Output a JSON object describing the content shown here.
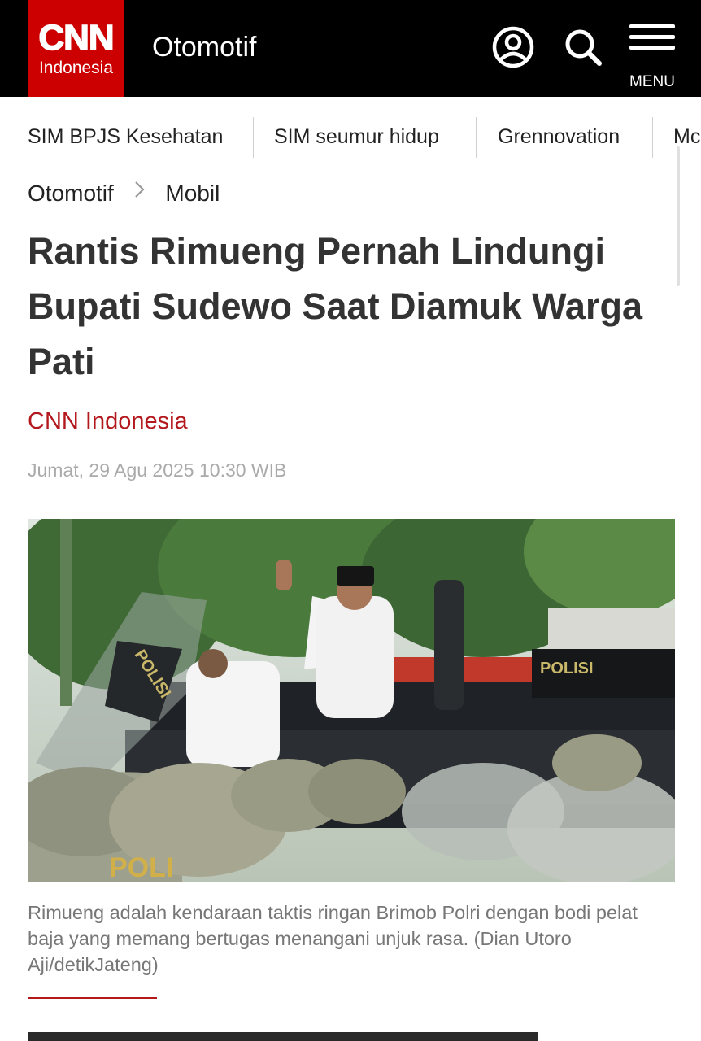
{
  "header": {
    "logo": {
      "brand": "CNN",
      "sub": "Indonesia",
      "color": "#cc0000"
    },
    "section": "Otomotif",
    "icons": [
      "user-account-icon",
      "search-icon",
      "hamburger-menu-icon"
    ],
    "menu_label": "MENU"
  },
  "trending": [
    "SIM BPJS Kesehatan",
    "SIM seumur hidup",
    "Grennovation",
    "Mc"
  ],
  "breadcrumb": {
    "parent": "Otomotif",
    "current": "Mobil"
  },
  "article": {
    "headline": "Rantis Rimueng Pernah Lindungi Bupati Sudewo Saat Diamuk Warga Pati",
    "author": "CNN Indonesia",
    "date": "Jumat, 29 Agu 2025 10:30 WIB",
    "caption": "Rimueng adalah kendaraan taktis ringan Brimob Polri dengan bodi pelat baja yang memang bertugas menangani unjuk rasa. (Dian Utoro Aji/detikJateng)"
  },
  "photo": {
    "shield_text": "POLISI",
    "helmet_text": "POLI"
  },
  "colors": {
    "accent": "#b3181d",
    "header_bg": "#000000"
  }
}
